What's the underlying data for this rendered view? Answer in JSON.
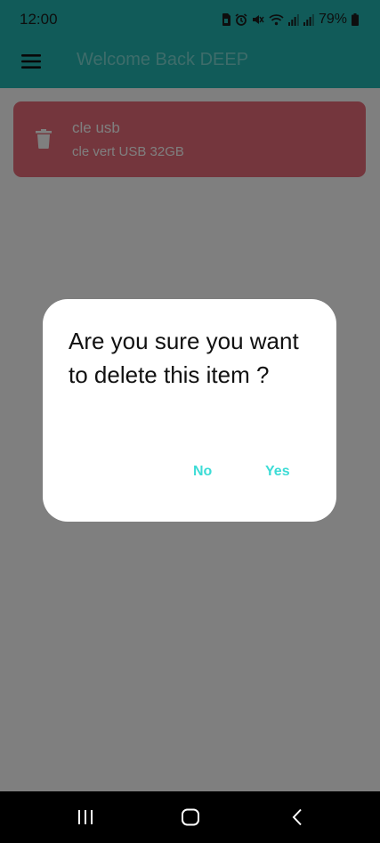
{
  "status_bar": {
    "time": "12:00",
    "battery_percent": "79%",
    "icons": [
      "sim-card-icon",
      "alarm-icon",
      "mute-icon",
      "wifi-icon",
      "signal-icon",
      "signal-icon",
      "battery-icon"
    ]
  },
  "app_bar": {
    "menu_icon": "hamburger-menu-icon",
    "title": "Welcome Back DEEP"
  },
  "items": [
    {
      "name": "cle usb",
      "description": "cle vert USB 32GB",
      "action_icon": "trash-icon"
    }
  ],
  "dialog": {
    "message": "Are you sure you want to delete this item ?",
    "no_label": "No",
    "yes_label": "Yes"
  },
  "nav_bar": {
    "icons": [
      "recent-apps-icon",
      "home-icon",
      "back-icon"
    ]
  },
  "colors": {
    "app_bar": "#22b7b2",
    "card": "#e96d7b",
    "dialog_button": "#3ddcd6",
    "nav_bar": "#000000"
  }
}
